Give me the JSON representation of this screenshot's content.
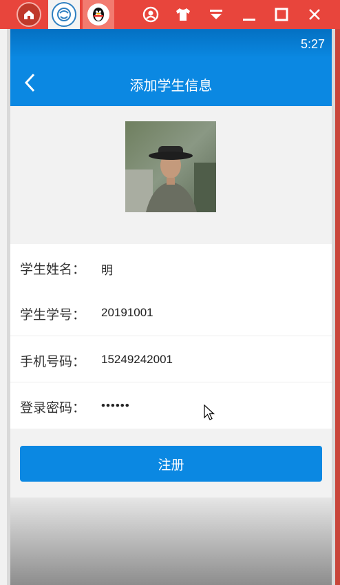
{
  "emulator": {
    "apps": [
      {
        "name": "home",
        "icon": "home-icon"
      },
      {
        "name": "circle",
        "icon": "circle-app-icon"
      },
      {
        "name": "qq",
        "icon": "qq-penguin-icon"
      }
    ],
    "controls": [
      "user-icon",
      "shirt-icon",
      "dropdown-icon",
      "minimize-icon",
      "maximize-icon",
      "close-icon"
    ],
    "accent": "#e8453c"
  },
  "status_bar": {
    "time": "5:27"
  },
  "app_bar": {
    "title": "添加学生信息",
    "color": "#0b88e2"
  },
  "form": {
    "name_label": "学生姓名：",
    "name_value": "明",
    "id_label": "学生学号：",
    "id_value": "20191001",
    "phone_label": "手机号码：",
    "phone_value": "15249242001",
    "password_label": "登录密码：",
    "password_value": "••••••"
  },
  "register_button": {
    "label": "注册"
  }
}
